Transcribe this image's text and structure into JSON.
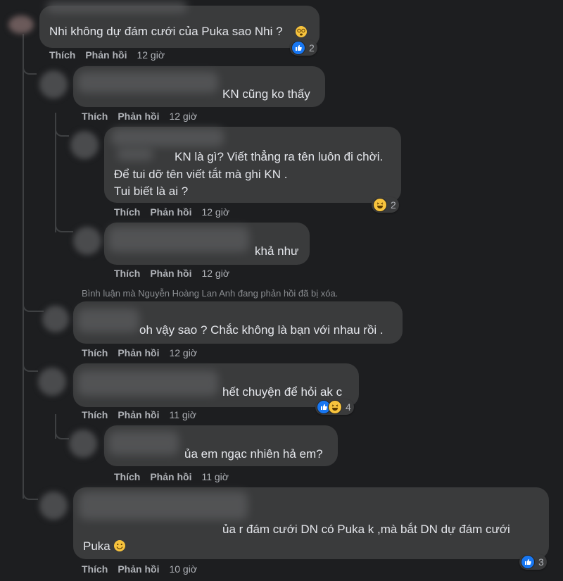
{
  "actions": {
    "like": "Thích",
    "reply": "Phản hồi"
  },
  "comments": [
    {
      "text": "Nhi không dự đám cưới của Puka sao Nhi ?",
      "time": "12 giờ",
      "reactions": "2"
    },
    {
      "text": "KN cũng ko thấy",
      "time": "12 giờ"
    },
    {
      "line1": "KN là gì? Viết thẳng ra tên luôn đi chời.",
      "line2": "Để tui dỡ tên viết tắt mà ghi KN .",
      "line3": "Tui biết là ai ?",
      "time": "12 giờ",
      "reactions": "2"
    },
    {
      "text": "khả như",
      "time": "12 giờ"
    },
    {
      "text": "oh vậy sao ? Chắc không là bạn với nhau rồi .",
      "time": "12 giờ"
    },
    {
      "text": "hết chuyện để hỏi ak c",
      "time": "11 giờ",
      "reactions": "4"
    },
    {
      "text": "ủa em ngạc nhiên hả em?",
      "time": "11 giờ"
    },
    {
      "line1": "ủa r đám cưới DN có Puka k ,mà bắt DN dự đám cưới",
      "line2": "Puka",
      "time": "10 giờ",
      "reactions": "3"
    }
  ],
  "deleted_notice": "Bình luận mà Nguyễn Hoàng Lan Anh đang phản hồi đã bị xóa.",
  "colors": {
    "background": "#1d1e20",
    "bubble": "#3a3b3c",
    "like": "#1877f2",
    "haha": "#f7c33d",
    "text": "#e4e6eb",
    "muted": "#b0b3b8"
  },
  "icons": [
    "like-icon",
    "haha-icon",
    "dizzy-face-icon",
    "smile-icon"
  ]
}
